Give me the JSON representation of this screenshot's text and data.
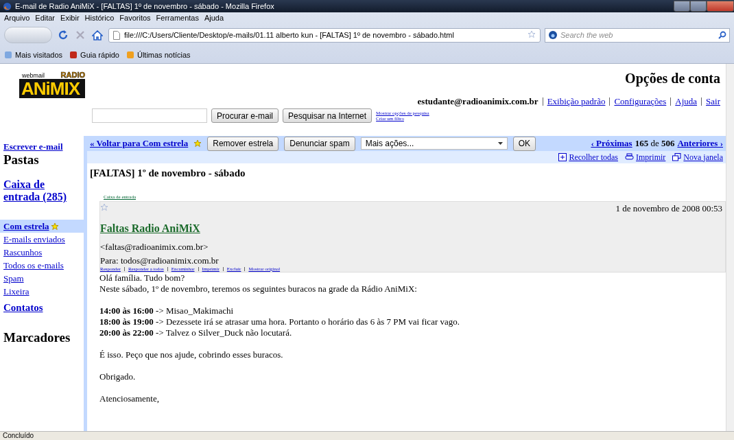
{
  "window": {
    "title": "E-mail de Radio AniMiX - [FALTAS] 1º de novembro - sábado - Mozilla Firefox"
  },
  "menu": [
    "Arquivo",
    "Editar",
    "Exibir",
    "Histórico",
    "Favoritos",
    "Ferramentas",
    "Ajuda"
  ],
  "toolbar": {
    "url": "file:///C:/Users/Cliente/Desktop/e-mails/01.11 alberto kun - [FALTAS] 1º de novembro - sábado.html",
    "search_placeholder": "Search the web"
  },
  "bookmarks": [
    "Mais visitados",
    "Guia rápido",
    "Últimas notícias"
  ],
  "logo": {
    "caption": "webmail",
    "badge": "RADIO",
    "name": "ANiMIX"
  },
  "account": {
    "title": "Opções de conta",
    "email": "estudante@radioanimix.com.br",
    "links": [
      "Exibição padrão",
      "Configurações",
      "Ajuda",
      "Sair"
    ]
  },
  "search": {
    "buttons": [
      "Procurar e-mail",
      "Pesquisar na Internet"
    ],
    "links": [
      "Mostrar opções de pesquisa",
      "Criar um filtro"
    ]
  },
  "sidebar": {
    "compose": "Escrever e-mail",
    "folders_heading": "Pastas",
    "inbox": "Caixa de entrada (285)",
    "folders": [
      {
        "label": "Com estrela",
        "selected": true,
        "starred": true
      },
      {
        "label": "E-mails enviados",
        "selected": false,
        "starred": false
      },
      {
        "label": "Rascunhos",
        "selected": false,
        "starred": false
      },
      {
        "label": "Todos os e-mails",
        "selected": false,
        "starred": false
      },
      {
        "label": "Spam",
        "selected": false,
        "starred": false
      },
      {
        "label": "Lixeira",
        "selected": false,
        "starred": false
      }
    ],
    "contacts": "Contatos",
    "labels_heading": "Marcadores"
  },
  "actions": {
    "back": "« Voltar para Com estrela",
    "buttons": [
      "Remover estrela",
      "Denunciar spam"
    ],
    "more": "Mais ações...",
    "ok": "OK",
    "prev": "‹ Próximas",
    "position": "**165** de **506**",
    "next": "Anteriores ›"
  },
  "tools": [
    {
      "kind": "collapse",
      "label": "Recolher todas"
    },
    {
      "kind": "print",
      "label": "Imprimir"
    },
    {
      "kind": "window",
      "label": "Nova janela"
    }
  ],
  "message": {
    "subject": "[FALTAS] 1º de novembro - sábado",
    "label": "Caixa de entrada",
    "starred": false,
    "date": "1 de novembro de 2008 00:53",
    "sender": "Faltas Radio AniMiX",
    "address": "<faltas@radioanimix.com.br>",
    "to": "Para: todos@radioanimix.com.br",
    "links": [
      "Responder",
      "Responder a todos",
      "Encaminhar",
      "Imprimir",
      "Excluir",
      "Mostrar original"
    ],
    "body": [
      [
        "Olá família. Tudo bom?",
        "Neste sábado, 1º de novembro, teremos os seguintes buracos na grade da Rádio AniMiX:"
      ],
      [
        "**14:00 às 16:00** -> Misao_Makimachi",
        "**18:00 às 19:00** -> Dezessete irá se atrasar uma hora. Portanto o horário das 6 às 7 PM vai ficar vago.",
        "**20:00 às 22:00** -> Talvez o Silver_Duck não locutará."
      ],
      [
        "É isso. Peço que nos ajude, cobrindo esses buracos."
      ],
      [
        "Obrigado."
      ],
      [
        "Atenciosamente,"
      ]
    ]
  },
  "status": "Concluído"
}
